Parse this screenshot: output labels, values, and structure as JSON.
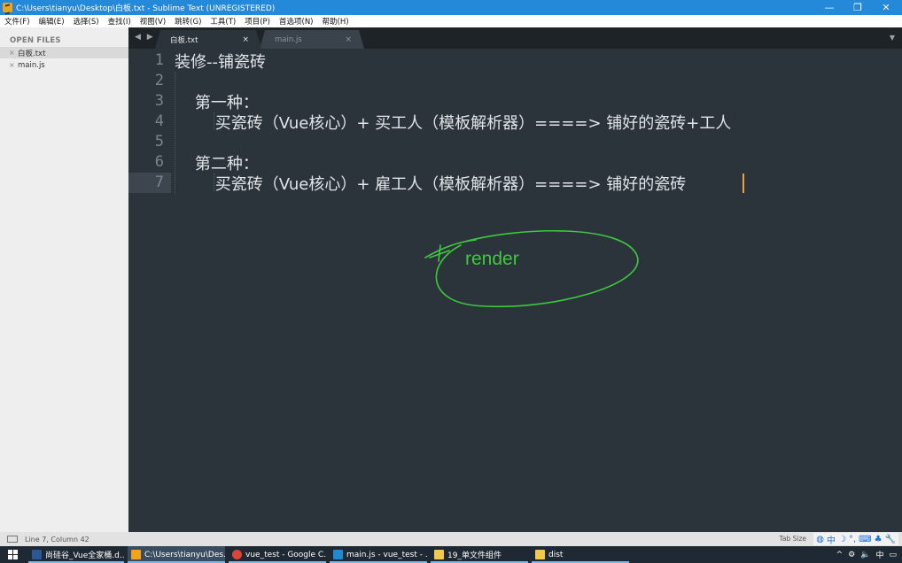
{
  "window": {
    "title": "C:\\Users\\tianyu\\Desktop\\白板.txt - Sublime Text (UNREGISTERED)",
    "minimize": "—",
    "maximize": "❐",
    "close": "✕"
  },
  "menu": [
    "文件(F)",
    "编辑(E)",
    "选择(S)",
    "查找(I)",
    "视图(V)",
    "跳转(G)",
    "工具(T)",
    "项目(P)",
    "首选项(N)",
    "帮助(H)"
  ],
  "sidebar": {
    "header": "OPEN FILES",
    "files": [
      {
        "name": "白板.txt",
        "close": "×",
        "active": true
      },
      {
        "name": "main.js",
        "close": "×",
        "active": false
      }
    ]
  },
  "tabs": {
    "nav": "◀ ▶",
    "items": [
      {
        "label": "白板.txt",
        "close": "×",
        "active": true
      },
      {
        "label": "main.js",
        "close": "×",
        "active": false
      }
    ],
    "menu": "▼"
  },
  "editor": {
    "line_numbers": [
      "1",
      "2",
      "3",
      "4",
      "5",
      "6",
      "7"
    ],
    "current_line": 7,
    "lines": [
      "装修--铺瓷砖",
      "",
      "    第一种：",
      "        买瓷砖（Vue核心）+ 买工人（模板解析器）====> 铺好的瓷砖+工人",
      "",
      "    第二种：",
      "        买瓷砖（Vue核心）+ 雇工人（模板解析器）====> 铺好的瓷砖"
    ],
    "annotation": "render",
    "annotation_color": "#3ec93e"
  },
  "status": {
    "position": "Line 7, Column 42",
    "tab_size": "Tab Size",
    "ime": [
      "中",
      "☽",
      "°,",
      "⌨",
      "♣",
      "🔧"
    ]
  },
  "taskbar": {
    "start_icon": "windows-logo-icon",
    "items": [
      {
        "label": "尚硅谷_Vue全家桶.d...",
        "icon_color": "#2b5797",
        "active": false
      },
      {
        "label": "C:\\Users\\tianyu\\Des...",
        "icon_color": "#f3a21d",
        "active": true
      },
      {
        "label": "vue_test - Google C...",
        "icon_color": "#db4437",
        "active": false
      },
      {
        "label": "main.js - vue_test - ...",
        "icon_color": "#1f8ad2",
        "active": false
      },
      {
        "label": "19_单文件组件",
        "icon_color": "#f2c94c",
        "active": false
      },
      {
        "label": "dist",
        "icon_color": "#f2c94c",
        "active": false
      }
    ],
    "tray": [
      "^",
      "⚙",
      "🔈",
      "中"
    ],
    "notification": "▭"
  }
}
